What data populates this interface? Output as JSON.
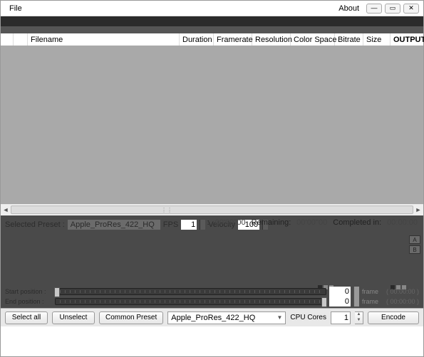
{
  "menu": {
    "file": "File",
    "about": "About"
  },
  "winbtn": {
    "min": "—",
    "max": "▭",
    "close": "✕"
  },
  "grid": {
    "headers": [
      "",
      "",
      "Filename",
      "Duration",
      "Framerate",
      "Resolution",
      "Color Space",
      "Bitrate",
      "Size",
      "OUTPUT"
    ]
  },
  "panel": {
    "selected_preset_label": "Selected Preset :",
    "selected_preset_value": "Apple_ProRes_422_HQ",
    "fps_label": "FPS",
    "fps_value": "1",
    "velocity_label": "Velocity",
    "velocity_value": "100",
    "elapsed_sep": ":",
    "elapsed": "00'00''00",
    "remaining_label": "Remaining:",
    "remaining": "00'00''00",
    "completed_label": "Completed in:",
    "completed": "00:00:00",
    "toggle_a": "A",
    "toggle_b": "B",
    "start_label": "Start position :",
    "end_label": "End position :",
    "start_value": "0",
    "end_value": "0",
    "frame_unit": "frame",
    "frame_time": "( 00:00:00 )"
  },
  "bottom": {
    "select_all": "Select all",
    "unselect": "Unselect",
    "common_preset": "Common Preset",
    "preset_value": "Apple_ProRes_422_HQ",
    "cpu_label": "CPU Cores",
    "cpu_value": "1",
    "encode": "Encode"
  }
}
